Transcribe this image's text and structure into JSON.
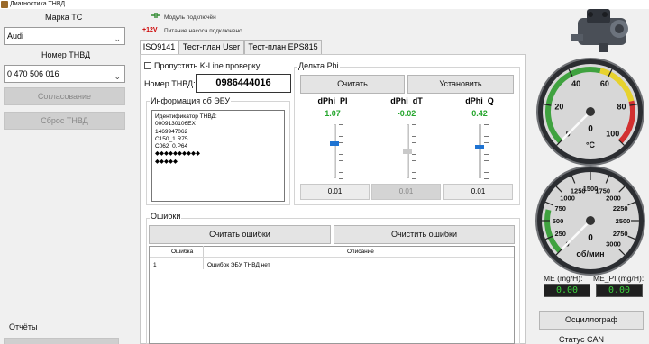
{
  "window": {
    "title": "Диагностика ТНВД"
  },
  "left": {
    "brand_label": "Марка ТС",
    "brand_value": "Audi",
    "tnvd_label": "Номер ТНВД",
    "tnvd_value": "0 470 506 016",
    "agree_button": "Согласование",
    "reset_button": "Сброс ТНВД",
    "reports_label": "Отчёты"
  },
  "status": {
    "module": "Модуль подключён",
    "voltage": "+12V",
    "pump_power": "Питание насоса подключено"
  },
  "tabs": [
    "ISO9141",
    "Тест-план User",
    "Тест-план EPS815"
  ],
  "iso": {
    "skip_kline": "Пропустить K-Line проверку",
    "tnvd_number_label": "Номер ТНВД:",
    "tnvd_number_value": "0986444016",
    "ecu_info_label": "Информация об ЭБУ",
    "ecu_info_lines": [
      "Идентификатор ТНВД:",
      "0009130106EX",
      "1469947062",
      "C150_1.R75",
      "C062_0.P64",
      "◆◆◆◆◆◆◆◆◆◆",
      "◆◆◆◆◆"
    ]
  },
  "delta": {
    "group_label": "Дельта Phi",
    "read_button": "Считать",
    "set_button": "Установить",
    "channels": [
      {
        "name": "dPhi_PI",
        "value": "1.07",
        "box": "0.01",
        "level": 0.65,
        "accent": "#1e73d2"
      },
      {
        "name": "dPhi_dT",
        "value": "-0.02",
        "box": "0.01",
        "level": 0.5,
        "accent": "#c9c9c9"
      },
      {
        "name": "dPhi_Q",
        "value": "0.42",
        "box": "0.01",
        "level": 0.58,
        "accent": "#1e73d2"
      }
    ]
  },
  "errors": {
    "group_label": "Ошибки",
    "read_button": "Считать ошибки",
    "clear_button": "Очистить ошибки",
    "columns": [
      "Ошибка",
      "Описание"
    ],
    "rows": [
      {
        "num": "1",
        "code": "",
        "desc": "Ошибок ЭБУ ТНВД нет"
      }
    ]
  },
  "temp_gauge": {
    "ticks": [
      "0",
      "20",
      "40",
      "60",
      "80",
      "100"
    ],
    "value": "0",
    "unit": "°C",
    "level": 0
  },
  "rpm_gauge": {
    "ticks": [
      "0",
      "250",
      "500",
      "750",
      "1000",
      "1250",
      "1500",
      "1750",
      "2000",
      "2250",
      "2500",
      "2750",
      "3000"
    ],
    "value": "0",
    "unit": "об/мин",
    "level": 0
  },
  "readouts": {
    "me_label": "ME (mg/H):",
    "me_value": "0.00",
    "me_pi_label": "ME_PI (mg/H):",
    "me_pi_value": "0.00",
    "osc_button": "Осциллограф",
    "can_label": "Статус CAN"
  }
}
